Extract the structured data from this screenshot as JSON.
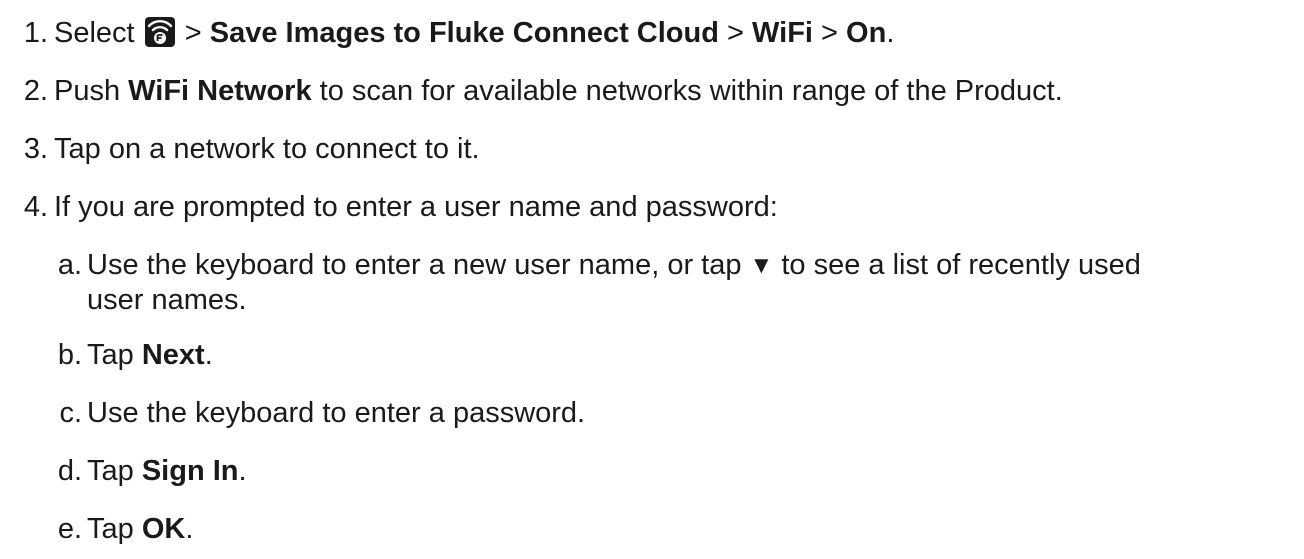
{
  "steps": [
    {
      "num": "1.",
      "select": "Select",
      "sep1": " > ",
      "b1": "Save Images to Fluke Connect Cloud",
      "sep2": " > ",
      "b2": "WiFi",
      "sep3": " > ",
      "b3": "On",
      "end": ".",
      "icon": "wifi-settings-icon"
    },
    {
      "num": "2.",
      "pre": "Push ",
      "bold": "WiFi Network",
      "post": " to scan for available networks within range of the Product."
    },
    {
      "num": "3.",
      "text": "Tap on a network to connect to it."
    },
    {
      "num": "4.",
      "text": "If you are prompted to enter a user name and password:"
    }
  ],
  "substeps": [
    {
      "num": "a.",
      "pre": "Use the keyboard to enter a new user name, or tap ",
      "glyph": "▼",
      "post": " to see a list of recently used",
      "line2": "user names."
    },
    {
      "num": "b.",
      "pre": "Tap ",
      "bold": "Next",
      "post": "."
    },
    {
      "num": "c.",
      "text": "Use the keyboard to enter a password."
    },
    {
      "num": "d.",
      "pre": "Tap ",
      "bold": "Sign In",
      "post": "."
    },
    {
      "num": "e.",
      "pre": "Tap ",
      "bold": "OK",
      "post": "."
    }
  ]
}
